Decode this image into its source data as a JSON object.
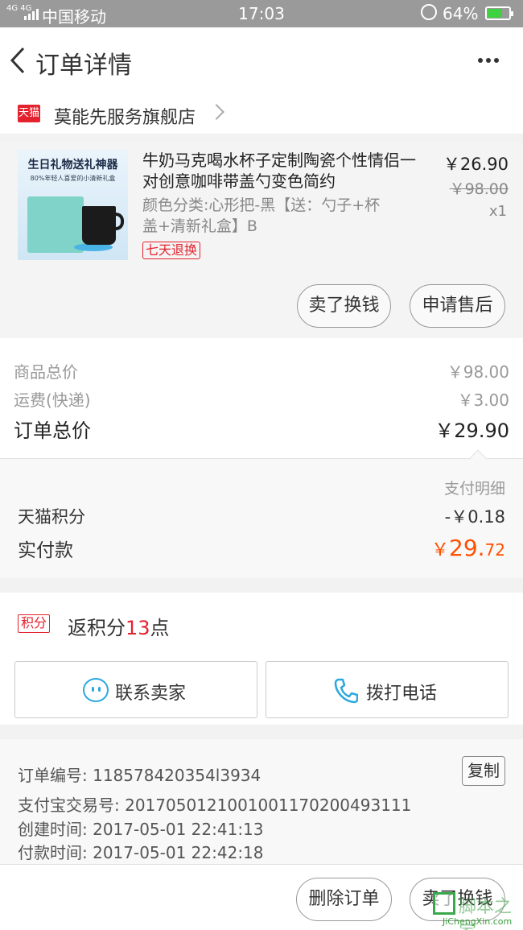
{
  "status_bar": {
    "network": "4G 4G",
    "carrier": "中国移动",
    "time": "17:03",
    "battery": "64%",
    "battery_level": 0.64
  },
  "nav": {
    "title": "订单详情"
  },
  "store": {
    "logo_text": "天猫",
    "name": "莫能先服务旗舰店"
  },
  "product": {
    "image_text_1": "生日礼物送礼神器",
    "image_text_2": "80%年轻人喜爱的小清新礼盒",
    "title": "牛奶马克喝水杯子定制陶瓷个性情侣一对创意咖啡带盖勺变色简约",
    "spec": "颜色分类:心形把-黑【送：勺子+杯盖+清新礼盒】B",
    "tag": "七天退换",
    "price": "￥26.90",
    "original_price": "￥98.00",
    "quantity": "x1",
    "actions": [
      "卖了换钱",
      "申请售后"
    ]
  },
  "totals": {
    "goods_label": "商品总价",
    "goods_value": "￥98.00",
    "shipping_label": "运费(快递)",
    "shipping_value": "￥3.00",
    "order_total_label": "订单总价",
    "order_total_value": "￥29.90"
  },
  "payment": {
    "detail_label": "支付明细",
    "points_label": "天猫积分",
    "points_value": "-￥0.18",
    "paid_label": "实付款",
    "paid_currency": "￥",
    "paid_int": "29.",
    "paid_dec": "72",
    "accent_color": "#ff5000"
  },
  "rewards": {
    "badge": "积分",
    "text_prefix": "返积分",
    "points": "13",
    "text_suffix": "点"
  },
  "contact": {
    "seller_label": "联系卖家",
    "call_label": "拨打电话"
  },
  "order_info": {
    "order_no": "订单编号: 118578420354l3934",
    "copy_label": "复制",
    "alipay_no": "支付宝交易号: 2017050121001001170200493111",
    "created": "创建时间: 2017-05-01 22:41:13",
    "paid_time": "付款时间: 2017-05-01 22:42:18"
  },
  "footer": {
    "delete_label": "删除订单",
    "sell_label": "卖了换钱"
  },
  "watermark": {
    "zh": "脚本之家",
    "en": "JiChengXin.com"
  },
  "colors": {
    "brand_red": "#e4222e",
    "icon_blue": "#2aa8e0"
  }
}
